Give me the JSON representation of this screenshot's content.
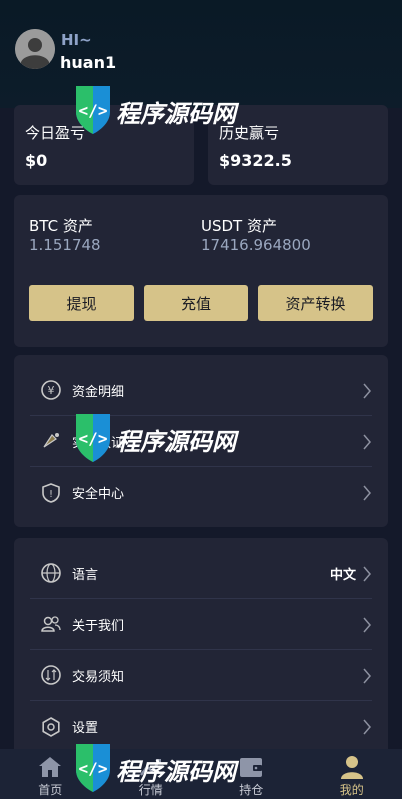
{
  "profile": {
    "greeting": "HI~",
    "username": "huan1"
  },
  "pnl": [
    {
      "label": "今日盈亏",
      "value": "$0"
    },
    {
      "label": "历史赢亏",
      "value": "$9322.5"
    }
  ],
  "assets": [
    {
      "label": "BTC 资产",
      "value": "1.151748"
    },
    {
      "label": "USDT 资产",
      "value": "17416.964800"
    }
  ],
  "actions": {
    "withdraw": "提现",
    "deposit": "充值",
    "convert": "资产转换"
  },
  "menu_group_1": [
    {
      "label": "资金明细",
      "icon": "fund-details-icon"
    },
    {
      "label": "实名认证",
      "icon": "verify-icon"
    },
    {
      "label": "安全中心",
      "icon": "shield-icon"
    }
  ],
  "menu_group_2": [
    {
      "label": "语言",
      "value": "中文",
      "icon": "globe-icon"
    },
    {
      "label": "关于我们",
      "icon": "users-icon"
    },
    {
      "label": "交易须知",
      "icon": "trade-icon"
    },
    {
      "label": "设置",
      "icon": "gear-icon"
    }
  ],
  "tabs": [
    {
      "label": "首页",
      "icon": "home-icon"
    },
    {
      "label": "行情",
      "icon": "chart-icon"
    },
    {
      "label": "持仓",
      "icon": "wallet-icon"
    },
    {
      "label": "我的",
      "icon": "user-icon",
      "active": true
    }
  ],
  "watermark": {
    "text": "程序源码网"
  },
  "colors": {
    "accent": "#d6c389",
    "background": "#14192a",
    "card": "#222536"
  }
}
